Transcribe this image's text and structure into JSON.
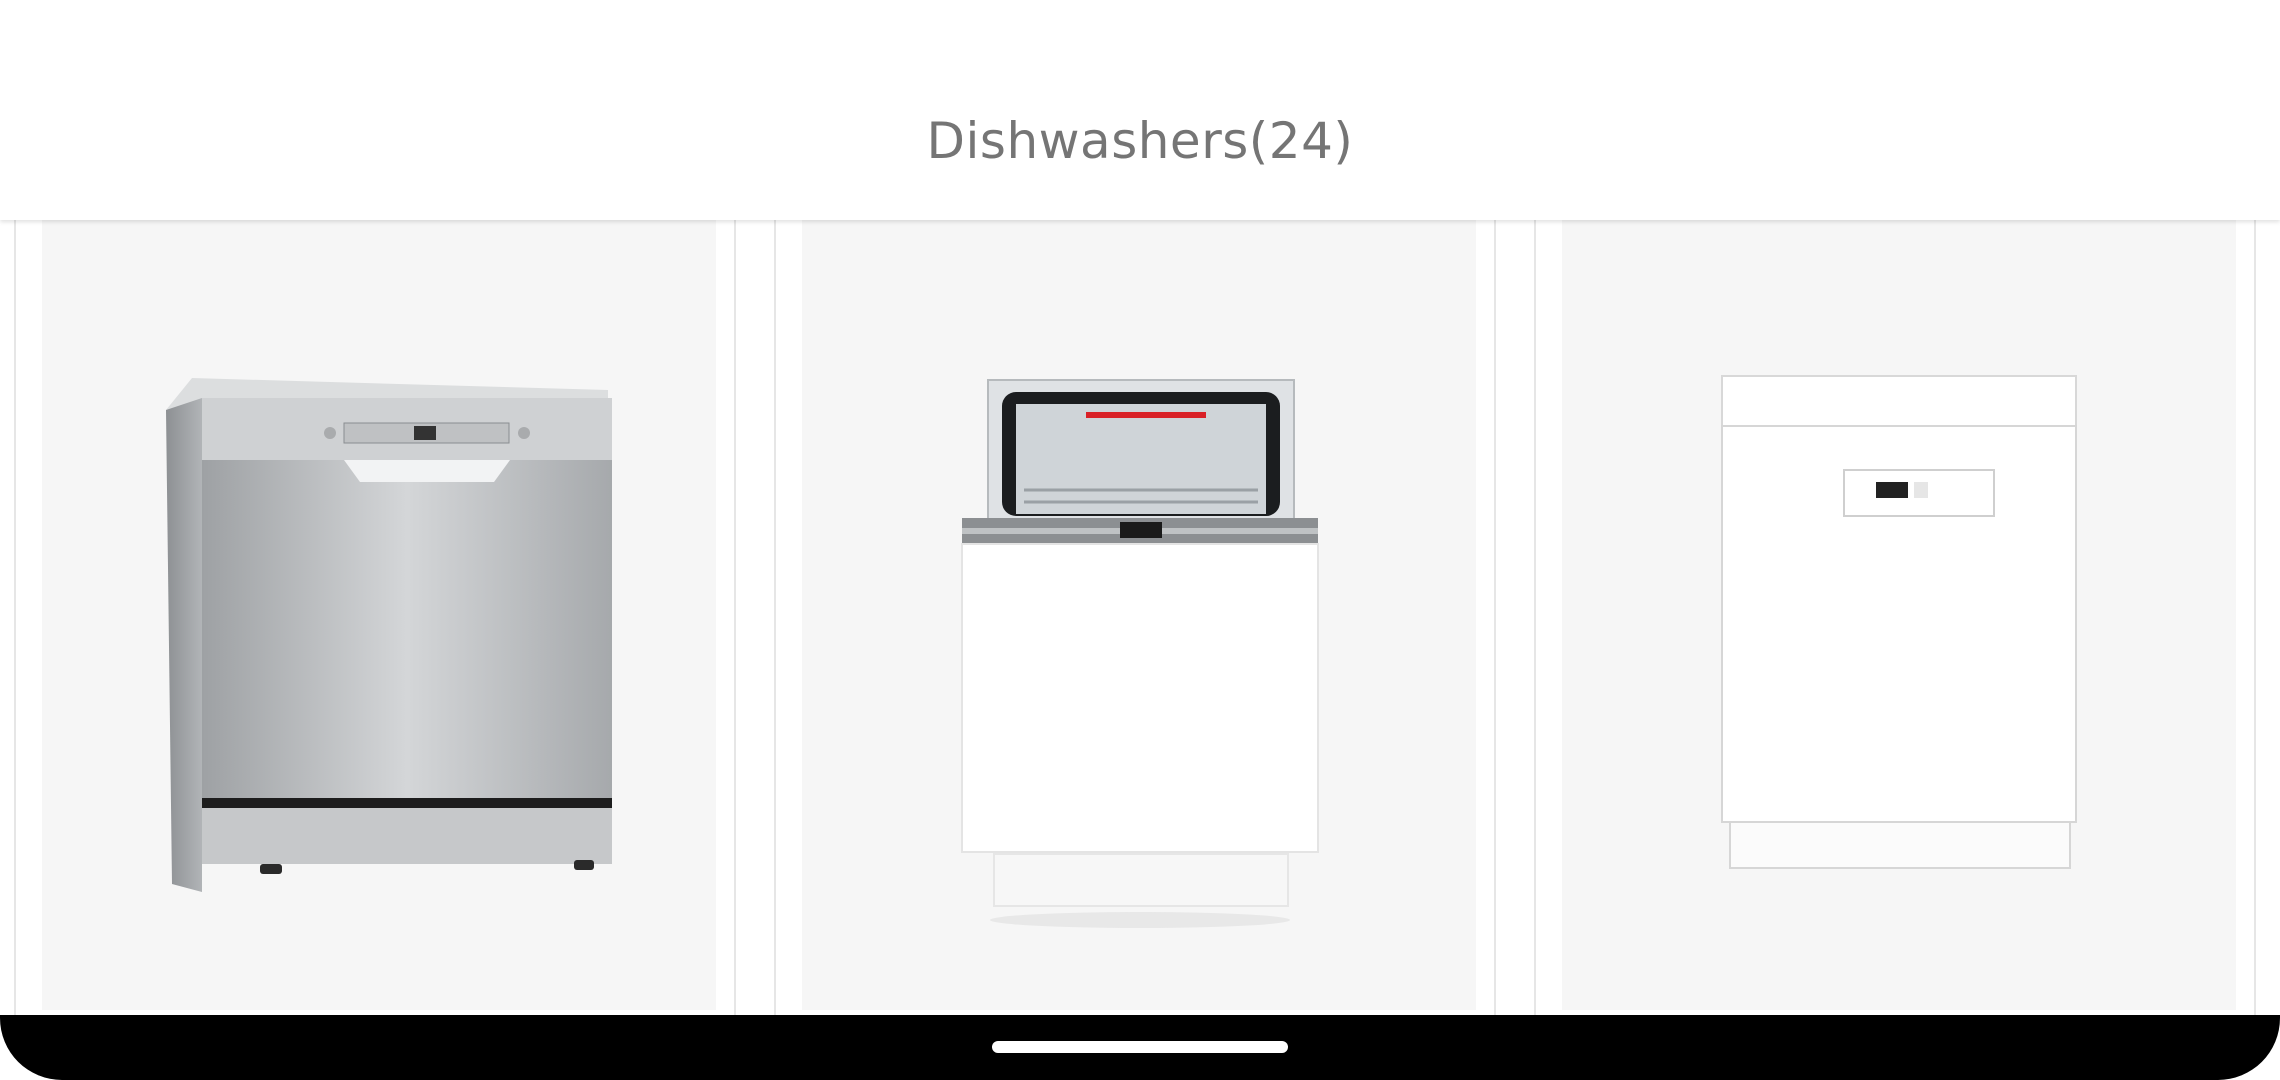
{
  "header": {
    "title": "Dishwashers(24)"
  },
  "products": [
    {
      "icon": "freestanding-stainless-dishwasher-image",
      "color": "#b8bbbe"
    },
    {
      "icon": "integrated-slimline-dishwasher-image",
      "color": "#f2f2f2"
    },
    {
      "icon": "freestanding-white-dishwasher-image",
      "color": "#ffffff"
    }
  ],
  "colors": {
    "card_background": "#f6f6f6",
    "title": "#757575",
    "navbar": "#000000"
  }
}
